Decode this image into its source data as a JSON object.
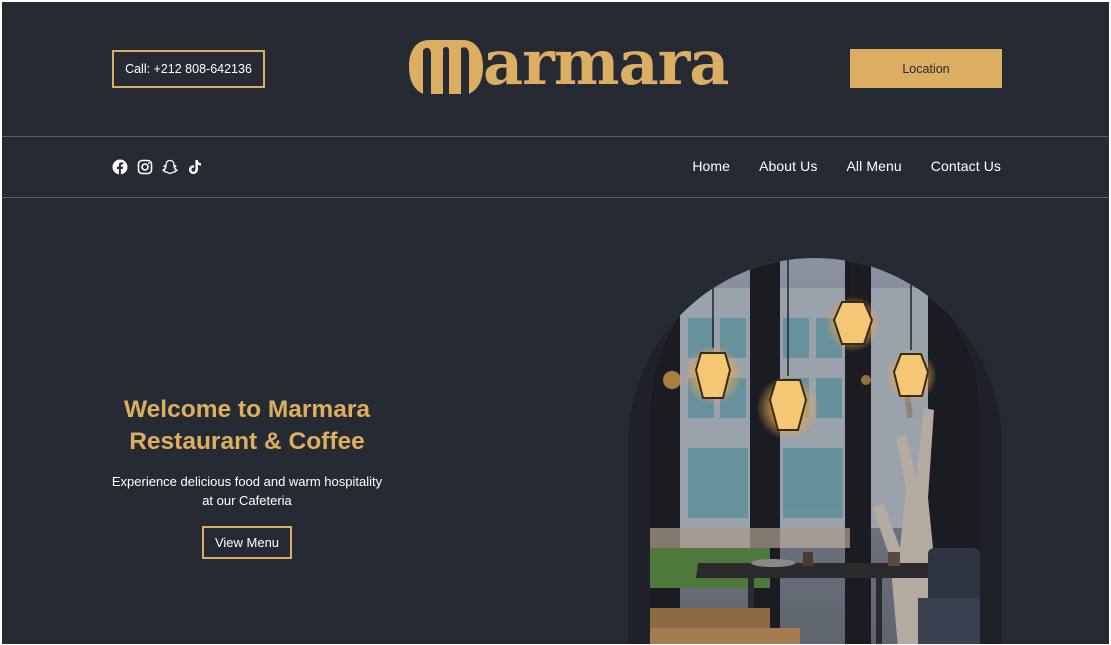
{
  "header": {
    "call_label": "Call: +212 808-642136",
    "logo_text": "armara",
    "location_label": "Location"
  },
  "socials": [
    {
      "icon": "facebook-icon"
    },
    {
      "icon": "instagram-icon"
    },
    {
      "icon": "snapchat-icon"
    },
    {
      "icon": "tiktok-icon"
    }
  ],
  "nav": {
    "items": [
      {
        "label": "Home"
      },
      {
        "label": "About Us"
      },
      {
        "label": "All Menu"
      },
      {
        "label": "Contact Us"
      }
    ]
  },
  "hero": {
    "title_line1": "Welcome to Marmara",
    "title_line2": "Restaurant & Coffee",
    "subtitle_line1": "Experience delicious food and warm hospitality",
    "subtitle_line2": "at our Cafeteria",
    "cta_label": "View Menu",
    "image": "cafe-interior-photo"
  },
  "colors": {
    "background": "#262a33",
    "accent": "#dcae62",
    "text": "#ffffff",
    "divider": "#5a5e66"
  }
}
